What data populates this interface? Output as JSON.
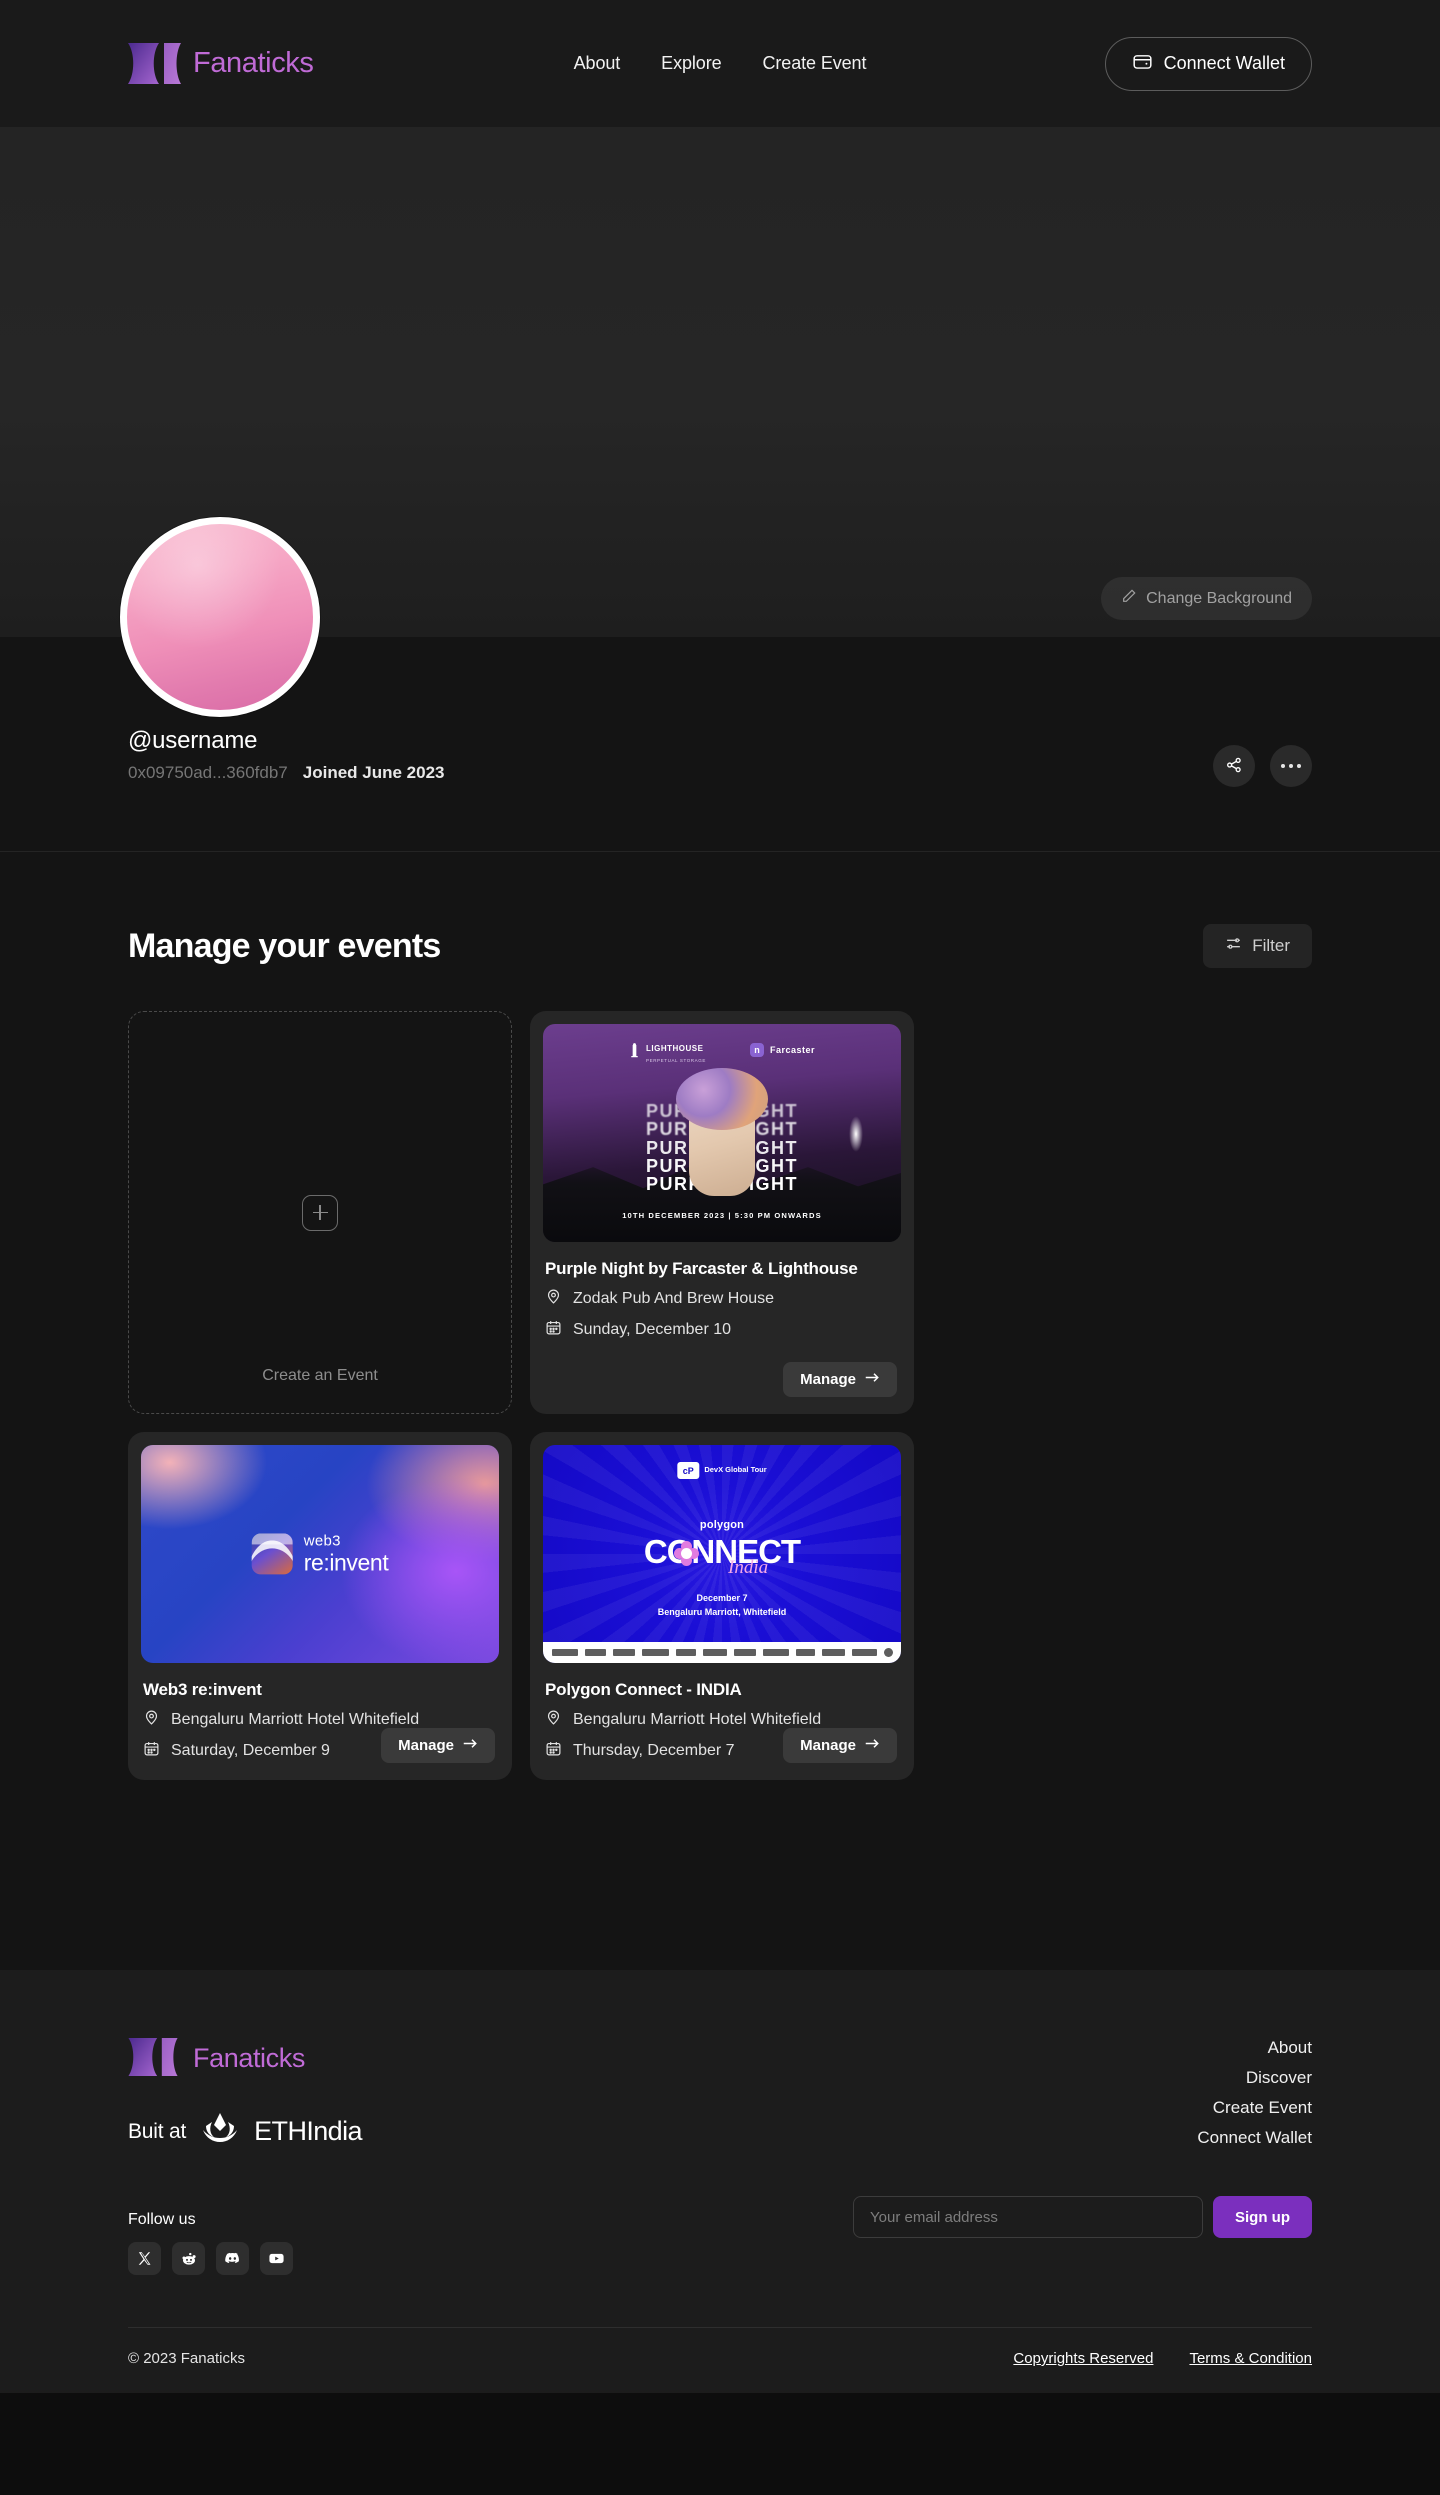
{
  "brand": {
    "name": "Fanaticks",
    "accent": "#c06bd6",
    "purple": "#7b2fbe"
  },
  "header": {
    "nav": [
      {
        "label": "About"
      },
      {
        "label": "Explore"
      },
      {
        "label": "Create Event"
      }
    ],
    "connect_wallet": "Connect Wallet"
  },
  "banner": {
    "change_background": "Change Background"
  },
  "profile": {
    "username": "@username",
    "wallet": "0x09750ad...360fdb7",
    "joined": "Joined June 2023"
  },
  "main": {
    "title": "Manage your events",
    "filter": "Filter",
    "create_card": {
      "label": "Create an Event"
    },
    "events": [
      {
        "title": "Purple Night by Farcaster & Lighthouse",
        "venue": "Zodak Pub And Brew House",
        "date": "Sunday, December 10",
        "manage": "Manage",
        "art": "purple-night",
        "poster": {
          "brand_1": "LIGHTHOUSE",
          "brand_1_sub": "PERPETUAL STORAGE",
          "brand_2": "Farcaster",
          "headline": "PURPLE NIGHT",
          "footer": "10TH DECEMBER 2023 | 5:30 PM ONWARDS"
        }
      },
      {
        "title": "Web3 re:invent",
        "venue": "Bengaluru Marriott Hotel Whitefield",
        "date": "Saturday, December 9",
        "manage": "Manage",
        "art": "web3-reinvent",
        "poster": {
          "line_1": "web3",
          "line_2": "re:invent"
        }
      },
      {
        "title": "Polygon Connect - INDIA",
        "venue": "Bengaluru Marriott Hotel Whitefield",
        "date": "Thursday, December 7",
        "manage": "Manage",
        "art": "polygon-connect",
        "poster": {
          "devx": "DevX Global Tour",
          "brand": "polygon",
          "headline": "CONNECT",
          "script": "India",
          "date": "December 7",
          "venue": "Bengaluru Marriott, Whitefield"
        }
      }
    ]
  },
  "footer": {
    "built_at": "Buit at",
    "eth_india": "ETHIndia",
    "follow_us": "Follow us",
    "socials": [
      {
        "name": "x-twitter"
      },
      {
        "name": "reddit"
      },
      {
        "name": "discord"
      },
      {
        "name": "youtube"
      }
    ],
    "links": [
      {
        "label": "About"
      },
      {
        "label": "Discover"
      },
      {
        "label": "Create Event"
      },
      {
        "label": "Connect Wallet"
      }
    ],
    "email_placeholder": "Your email address",
    "signup": "Sign up",
    "copyright": "© 2023 Fanaticks",
    "legal": [
      {
        "label": "Copyrights Reserved"
      },
      {
        "label": "Terms & Condition"
      }
    ]
  }
}
